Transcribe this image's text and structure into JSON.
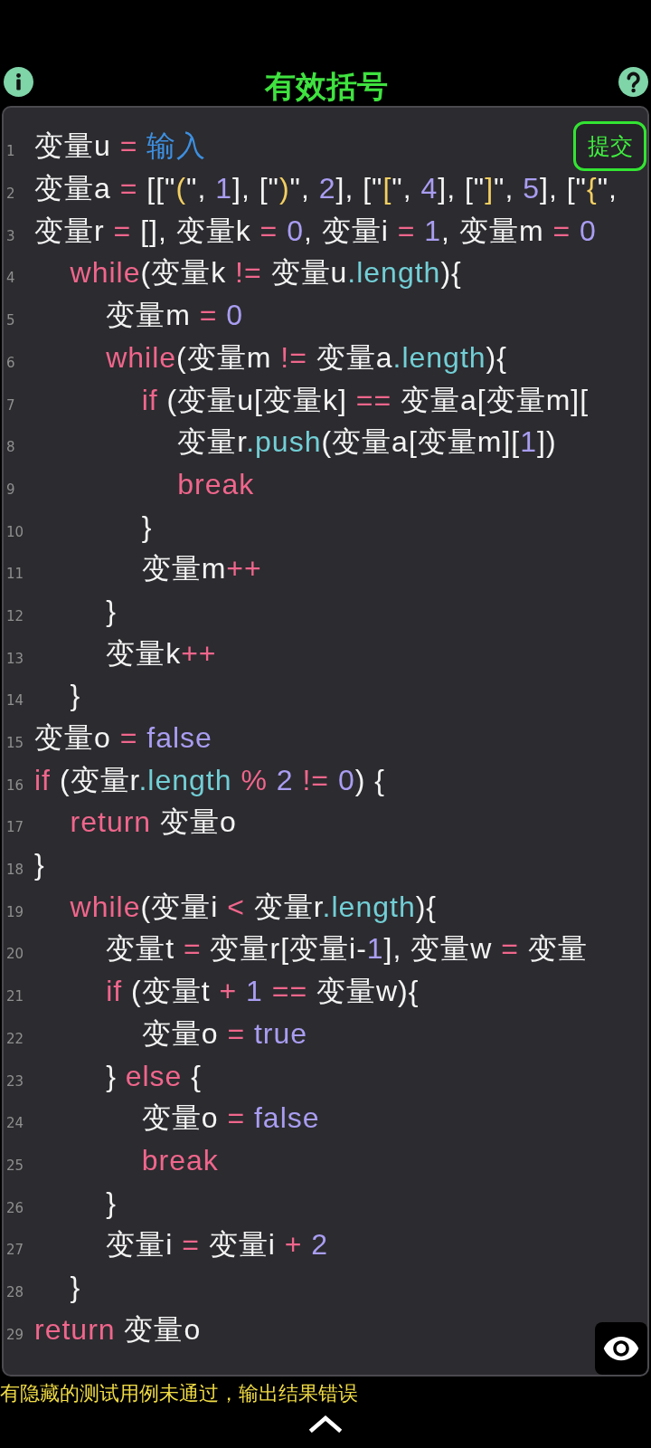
{
  "header": {
    "title": "有效括号"
  },
  "editor": {
    "submit_button": {
      "label": "提交"
    },
    "lines": [
      {
        "number": "1",
        "tokens": [
          {
            "kind": "plain",
            "text": "变量u "
          },
          {
            "kind": "operator",
            "text": "= "
          },
          {
            "kind": "builtin",
            "text": "输入"
          }
        ]
      },
      {
        "number": "2",
        "tokens": [
          {
            "kind": "plain",
            "text": "变量a "
          },
          {
            "kind": "operator",
            "text": "= "
          },
          {
            "kind": "plain",
            "text": "[[\""
          },
          {
            "kind": "string",
            "text": "("
          },
          {
            "kind": "plain",
            "text": "\", "
          },
          {
            "kind": "literal",
            "text": "1"
          },
          {
            "kind": "plain",
            "text": "], [\""
          },
          {
            "kind": "string",
            "text": ")"
          },
          {
            "kind": "plain",
            "text": "\", "
          },
          {
            "kind": "literal",
            "text": "2"
          },
          {
            "kind": "plain",
            "text": "], [\""
          },
          {
            "kind": "string",
            "text": "["
          },
          {
            "kind": "plain",
            "text": "\", "
          },
          {
            "kind": "literal",
            "text": "4"
          },
          {
            "kind": "plain",
            "text": "], [\""
          },
          {
            "kind": "string",
            "text": "]"
          },
          {
            "kind": "plain",
            "text": "\", "
          },
          {
            "kind": "literal",
            "text": "5"
          },
          {
            "kind": "plain",
            "text": "], [\""
          },
          {
            "kind": "string",
            "text": "{"
          },
          {
            "kind": "plain",
            "text": "\","
          }
        ]
      },
      {
        "number": "3",
        "tokens": [
          {
            "kind": "plain",
            "text": "变量r "
          },
          {
            "kind": "operator",
            "text": "= "
          },
          {
            "kind": "plain",
            "text": "[], 变量k "
          },
          {
            "kind": "operator",
            "text": "= "
          },
          {
            "kind": "literal",
            "text": "0"
          },
          {
            "kind": "plain",
            "text": ", 变量i "
          },
          {
            "kind": "operator",
            "text": "= "
          },
          {
            "kind": "literal",
            "text": "1"
          },
          {
            "kind": "plain",
            "text": ", 变量m "
          },
          {
            "kind": "operator",
            "text": "= "
          },
          {
            "kind": "literal",
            "text": "0"
          }
        ]
      },
      {
        "number": "4",
        "tokens": [
          {
            "kind": "keyword",
            "text": "    while"
          },
          {
            "kind": "plain",
            "text": "(变量k "
          },
          {
            "kind": "operator",
            "text": "!= "
          },
          {
            "kind": "plain",
            "text": "变量u"
          },
          {
            "kind": "property",
            "text": ".length"
          },
          {
            "kind": "plain",
            "text": "){"
          }
        ]
      },
      {
        "number": "5",
        "tokens": [
          {
            "kind": "plain",
            "text": "        变量m "
          },
          {
            "kind": "operator",
            "text": "= "
          },
          {
            "kind": "literal",
            "text": "0"
          }
        ]
      },
      {
        "number": "6",
        "tokens": [
          {
            "kind": "keyword",
            "text": "        while"
          },
          {
            "kind": "plain",
            "text": "(变量m "
          },
          {
            "kind": "operator",
            "text": "!= "
          },
          {
            "kind": "plain",
            "text": "变量a"
          },
          {
            "kind": "property",
            "text": ".length"
          },
          {
            "kind": "plain",
            "text": "){"
          }
        ]
      },
      {
        "number": "7",
        "tokens": [
          {
            "kind": "keyword",
            "text": "            if"
          },
          {
            "kind": "plain",
            "text": " (变量u[变量k] "
          },
          {
            "kind": "operator",
            "text": "== "
          },
          {
            "kind": "plain",
            "text": "变量a[变量m]["
          }
        ]
      },
      {
        "number": "8",
        "tokens": [
          {
            "kind": "plain",
            "text": "                变量r"
          },
          {
            "kind": "property",
            "text": ".push"
          },
          {
            "kind": "plain",
            "text": "(变量a[变量m]["
          },
          {
            "kind": "literal",
            "text": "1"
          },
          {
            "kind": "plain",
            "text": "])"
          }
        ]
      },
      {
        "number": "9",
        "tokens": [
          {
            "kind": "keyword",
            "text": "                break"
          }
        ]
      },
      {
        "number": "10",
        "tokens": [
          {
            "kind": "plain",
            "text": "            }"
          }
        ]
      },
      {
        "number": "11",
        "tokens": [
          {
            "kind": "plain",
            "text": "            变量m"
          },
          {
            "kind": "operator",
            "text": "++"
          }
        ]
      },
      {
        "number": "12",
        "tokens": [
          {
            "kind": "plain",
            "text": "        }"
          }
        ]
      },
      {
        "number": "13",
        "tokens": [
          {
            "kind": "plain",
            "text": "        变量k"
          },
          {
            "kind": "operator",
            "text": "++"
          }
        ]
      },
      {
        "number": "14",
        "tokens": [
          {
            "kind": "plain",
            "text": "    }"
          }
        ]
      },
      {
        "number": "15",
        "tokens": [
          {
            "kind": "plain",
            "text": "变量o "
          },
          {
            "kind": "operator",
            "text": "= "
          },
          {
            "kind": "literal",
            "text": "false"
          }
        ]
      },
      {
        "number": "16",
        "tokens": [
          {
            "kind": "keyword",
            "text": "if"
          },
          {
            "kind": "plain",
            "text": " (变量r"
          },
          {
            "kind": "property",
            "text": ".length"
          },
          {
            "kind": "operator",
            "text": " % "
          },
          {
            "kind": "literal",
            "text": "2"
          },
          {
            "kind": "operator",
            "text": " != "
          },
          {
            "kind": "literal",
            "text": "0"
          },
          {
            "kind": "plain",
            "text": ") {"
          }
        ]
      },
      {
        "number": "17",
        "tokens": [
          {
            "kind": "keyword",
            "text": "    return"
          },
          {
            "kind": "plain",
            "text": " 变量o"
          }
        ]
      },
      {
        "number": "18",
        "tokens": [
          {
            "kind": "plain",
            "text": "}"
          }
        ]
      },
      {
        "number": "19",
        "tokens": [
          {
            "kind": "keyword",
            "text": "    while"
          },
          {
            "kind": "plain",
            "text": "(变量i "
          },
          {
            "kind": "operator",
            "text": "< "
          },
          {
            "kind": "plain",
            "text": "变量r"
          },
          {
            "kind": "property",
            "text": ".length"
          },
          {
            "kind": "plain",
            "text": "){"
          }
        ]
      },
      {
        "number": "20",
        "tokens": [
          {
            "kind": "plain",
            "text": "        变量t "
          },
          {
            "kind": "operator",
            "text": "= "
          },
          {
            "kind": "plain",
            "text": "变量r[变量i-"
          },
          {
            "kind": "literal",
            "text": "1"
          },
          {
            "kind": "plain",
            "text": "], 变量w "
          },
          {
            "kind": "operator",
            "text": "= "
          },
          {
            "kind": "plain",
            "text": "变量"
          }
        ]
      },
      {
        "number": "21",
        "tokens": [
          {
            "kind": "keyword",
            "text": "        if"
          },
          {
            "kind": "plain",
            "text": " (变量t "
          },
          {
            "kind": "operator",
            "text": "+ "
          },
          {
            "kind": "literal",
            "text": "1"
          },
          {
            "kind": "operator",
            "text": " == "
          },
          {
            "kind": "plain",
            "text": "变量w){"
          }
        ]
      },
      {
        "number": "22",
        "tokens": [
          {
            "kind": "plain",
            "text": "            变量o "
          },
          {
            "kind": "operator",
            "text": "= "
          },
          {
            "kind": "literal",
            "text": "true"
          }
        ]
      },
      {
        "number": "23",
        "tokens": [
          {
            "kind": "plain",
            "text": "        } "
          },
          {
            "kind": "keyword",
            "text": "else"
          },
          {
            "kind": "plain",
            "text": " {"
          }
        ]
      },
      {
        "number": "24",
        "tokens": [
          {
            "kind": "plain",
            "text": "            变量o "
          },
          {
            "kind": "operator",
            "text": "= "
          },
          {
            "kind": "literal",
            "text": "false"
          }
        ]
      },
      {
        "number": "25",
        "tokens": [
          {
            "kind": "keyword",
            "text": "            break"
          }
        ]
      },
      {
        "number": "26",
        "tokens": [
          {
            "kind": "plain",
            "text": "        }"
          }
        ]
      },
      {
        "number": "27",
        "tokens": [
          {
            "kind": "plain",
            "text": "        变量i "
          },
          {
            "kind": "operator",
            "text": "= "
          },
          {
            "kind": "plain",
            "text": "变量i "
          },
          {
            "kind": "operator",
            "text": "+ "
          },
          {
            "kind": "literal",
            "text": "2"
          }
        ]
      },
      {
        "number": "28",
        "tokens": [
          {
            "kind": "plain",
            "text": "    }"
          }
        ]
      },
      {
        "number": "29",
        "tokens": [
          {
            "kind": "keyword",
            "text": "return"
          },
          {
            "kind": "plain",
            "text": " 变量o"
          }
        ]
      }
    ]
  },
  "message": "有隐藏的测试用例未通过，输出结果错误"
}
